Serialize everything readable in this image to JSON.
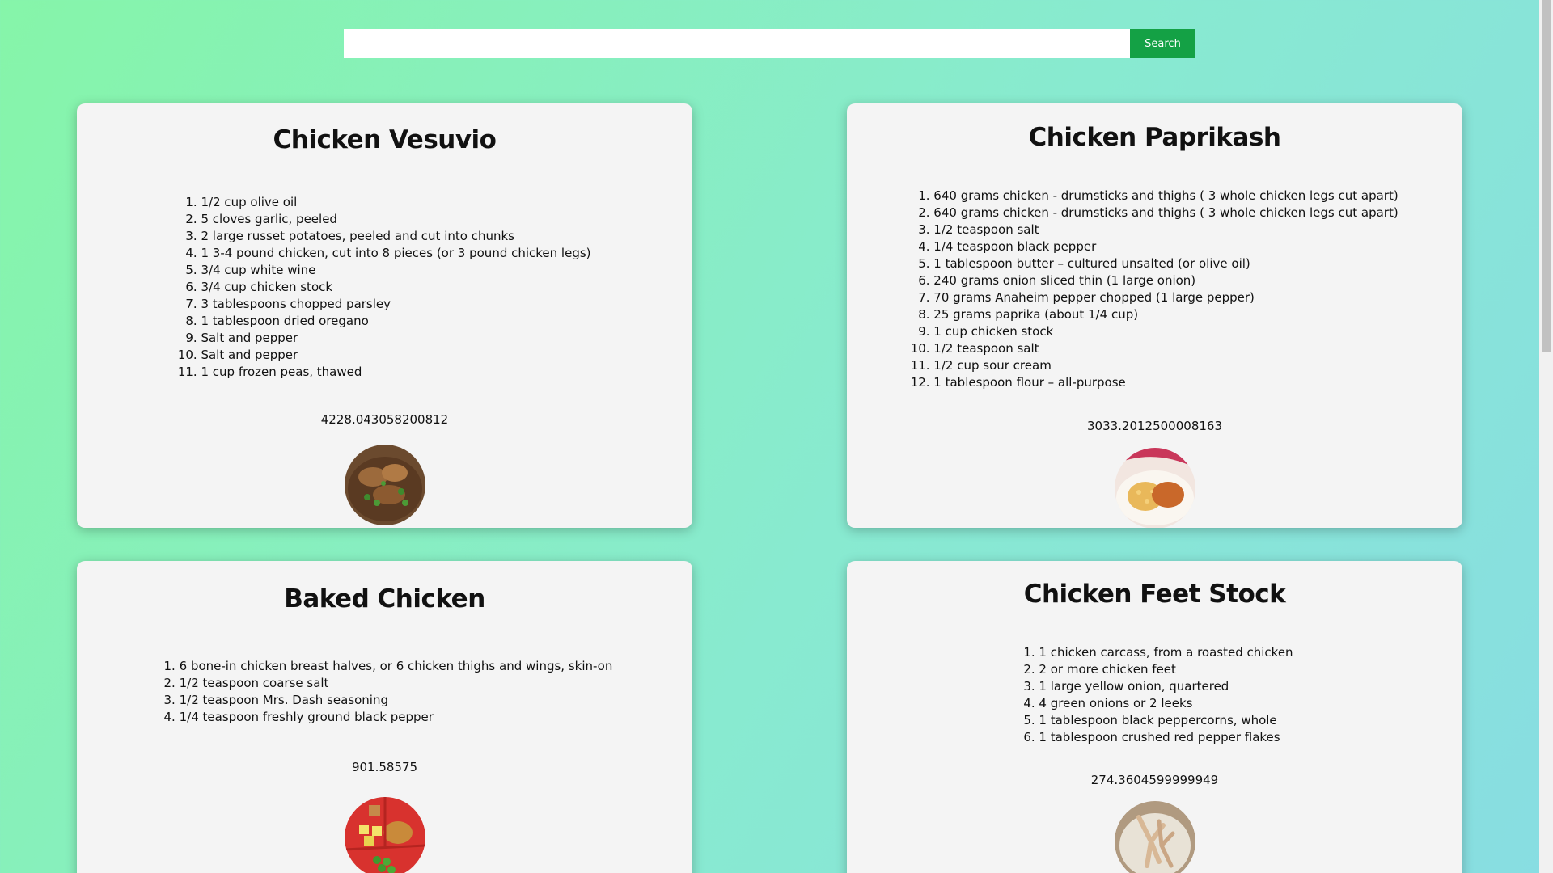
{
  "search": {
    "value": "",
    "placeholder": "",
    "button_label": "Search",
    "button_color": "#14a145"
  },
  "recipes": [
    {
      "title": "Chicken Vesuvio",
      "ingredients": [
        "1/2 cup olive oil",
        "5 cloves garlic, peeled",
        "2 large russet potatoes, peeled and cut into chunks",
        "1 3-4 pound chicken, cut into 8 pieces (or 3 pound chicken legs)",
        "3/4 cup white wine",
        "3/4 cup chicken stock",
        "3 tablespoons chopped parsley",
        "1 tablespoon dried oregano",
        "Salt and pepper",
        "Salt and pepper",
        "1 cup frozen peas, thawed"
      ],
      "calories": "4228.043058200812",
      "image": "chicken-vesuvio-photo"
    },
    {
      "title": "Chicken Paprikash",
      "ingredients": [
        "640 grams chicken - drumsticks and thighs ( 3 whole chicken legs cut apart)",
        "640 grams chicken - drumsticks and thighs ( 3 whole chicken legs cut apart)",
        "1/2 teaspoon salt",
        "1/4 teaspoon black pepper",
        "1 tablespoon butter – cultured unsalted (or olive oil)",
        "240 grams onion sliced thin (1 large onion)",
        "70 grams Anaheim pepper chopped (1 large pepper)",
        "25 grams paprika (about 1/4 cup)",
        "1 cup chicken stock",
        "1/2 teaspoon salt",
        "1/2 cup sour cream",
        "1 tablespoon flour – all-purpose"
      ],
      "calories": "3033.2012500008163",
      "image": "chicken-paprikash-photo"
    },
    {
      "title": "Baked Chicken",
      "ingredients": [
        "6 bone-in chicken breast halves, or 6 chicken thighs and wings, skin-on",
        "1/2 teaspoon coarse salt",
        "1/2 teaspoon Mrs. Dash seasoning",
        "1/4 teaspoon freshly ground black pepper"
      ],
      "calories": "901.58575",
      "image": "baked-chicken-photo"
    },
    {
      "title": "Chicken Feet Stock",
      "ingredients": [
        "1 chicken carcass, from a roasted chicken",
        "2 or more chicken feet",
        "1 large yellow onion, quartered",
        "4 green onions or 2 leeks",
        "1 tablespoon black peppercorns, whole",
        "1 tablespoon crushed red pepper flakes"
      ],
      "calories": "274.3604599999949",
      "image": "chicken-feet-stock-photo"
    }
  ]
}
